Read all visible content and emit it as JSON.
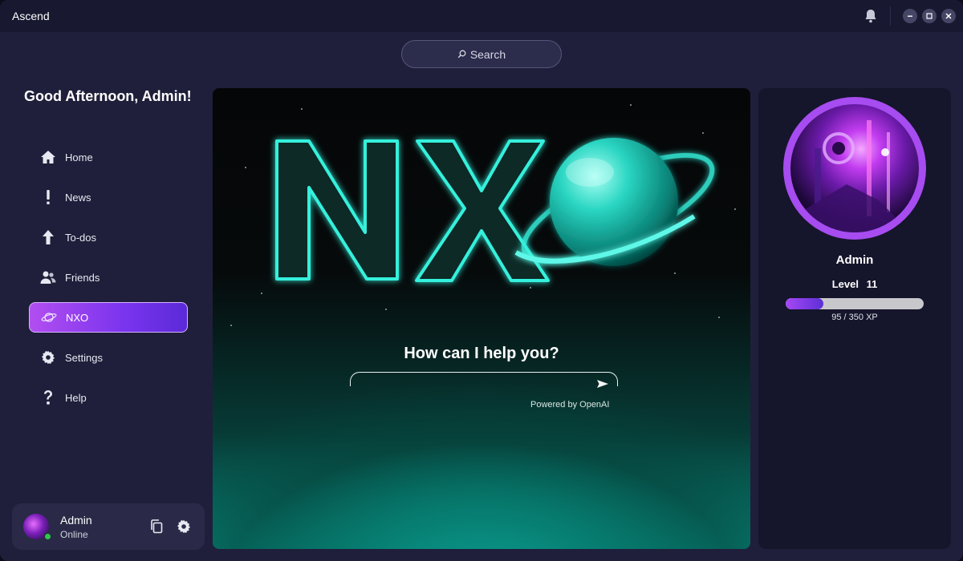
{
  "app": {
    "title": "Ascend"
  },
  "search": {
    "label": "Search",
    "icon": "search-icon"
  },
  "sidebar": {
    "greeting": "Good Afternoon, Admin!",
    "items": [
      {
        "label": "Home",
        "icon": "home-icon"
      },
      {
        "label": "News",
        "icon": "exclamation-icon"
      },
      {
        "label": "To-dos",
        "icon": "arrow-up-icon"
      },
      {
        "label": "Friends",
        "icon": "friends-icon"
      },
      {
        "label": "NXO",
        "icon": "planet-icon",
        "active": true
      },
      {
        "label": "Settings",
        "icon": "gear-icon"
      },
      {
        "label": "Help",
        "icon": "question-icon"
      }
    ],
    "user": {
      "name": "Admin",
      "status": "Online"
    }
  },
  "main": {
    "logo_text": "NXO",
    "prompt_title": "How can I help you?",
    "prompt_placeholder": "",
    "powered_by": "Powered by OpenAI"
  },
  "profile": {
    "name": "Admin",
    "level_label": "Level",
    "level_value": "11",
    "xp_text": "95 / 350 XP",
    "xp_current": 95,
    "xp_max": 350
  },
  "colors": {
    "accent": "#a64cf0",
    "teal": "#1ee0cc",
    "online": "#2ec84a"
  }
}
